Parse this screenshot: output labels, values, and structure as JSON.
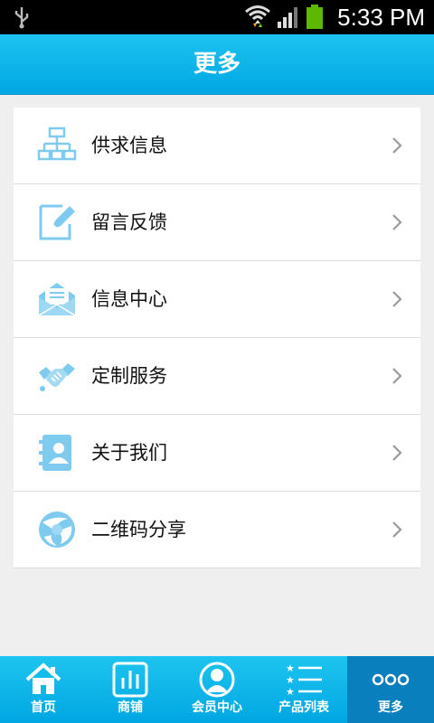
{
  "status_bar": {
    "time": "5:33 PM"
  },
  "header": {
    "title": "更多"
  },
  "menu": {
    "items": [
      {
        "label": "供求信息",
        "icon": "sitemap-icon"
      },
      {
        "label": "留言反馈",
        "icon": "note-edit-icon"
      },
      {
        "label": "信息中心",
        "icon": "envelope-icon"
      },
      {
        "label": "定制服务",
        "icon": "handshake-icon"
      },
      {
        "label": "关于我们",
        "icon": "contact-card-icon"
      },
      {
        "label": "二维码分享",
        "icon": "share-globe-icon"
      }
    ]
  },
  "tabbar": {
    "tabs": [
      {
        "label": "首页",
        "icon": "home-icon"
      },
      {
        "label": "商铺",
        "icon": "store-chart-icon"
      },
      {
        "label": "会员中心",
        "icon": "user-icon"
      },
      {
        "label": "产品列表",
        "icon": "star-list-icon"
      },
      {
        "label": "更多",
        "icon": "more-dots-icon",
        "active": true
      }
    ]
  },
  "colors": {
    "accent": "#00a7e3",
    "icon_blue": "#7ecbef",
    "active_tab": "#0a7fbd"
  }
}
